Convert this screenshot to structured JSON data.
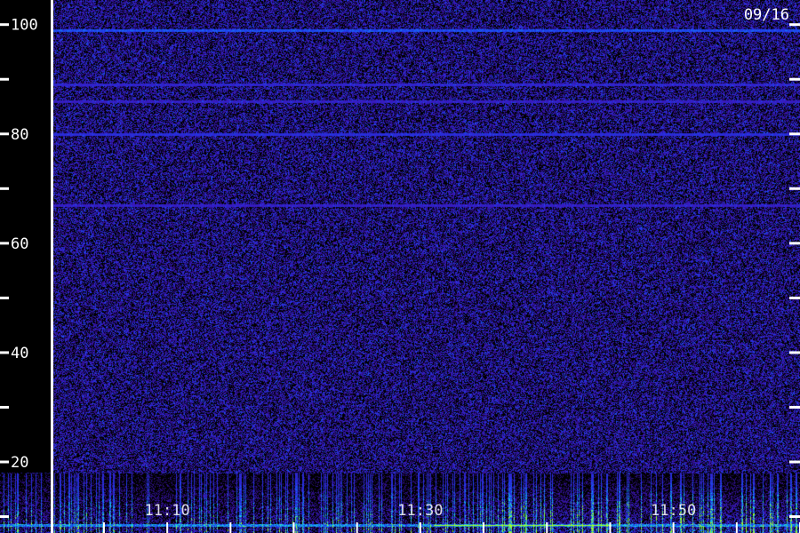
{
  "chart_data": {
    "type": "heatmap",
    "title": "",
    "date_label": "09/16",
    "y_axis": {
      "min": 7,
      "max": 104.5,
      "labeled_ticks": [
        100,
        80,
        60,
        40,
        20
      ],
      "minor_ticks": [
        90,
        70,
        50,
        30,
        10
      ],
      "labels": [
        "100",
        "80",
        "60",
        "40",
        "20"
      ]
    },
    "x_axis": {
      "labels": [
        "11:10",
        "11:30",
        "11:50"
      ],
      "label_positions_minutes": [
        10,
        30,
        50
      ],
      "range_minutes": [
        1,
        60
      ]
    },
    "persistent_lines": [
      {
        "y": 99,
        "strength": 0.85
      },
      {
        "y": 89,
        "strength": 0.4
      },
      {
        "y": 86,
        "strength": 0.3
      },
      {
        "y": 80,
        "strength": 0.55
      },
      {
        "y": 67,
        "strength": 0.3
      }
    ],
    "low_band_activity": {
      "y_range": [
        7,
        18
      ],
      "peak_y": 8.5,
      "strong_segment": {
        "y": 8.5,
        "x_minutes": [
          31,
          45
        ]
      }
    },
    "colors": {
      "background": "#000000",
      "low": "#200a6a",
      "mid": "#3a22d0",
      "high": "#20d0ff",
      "peak": "#a0ff20",
      "axis": "#ffffff"
    }
  }
}
